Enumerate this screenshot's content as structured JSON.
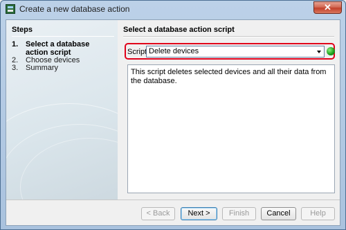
{
  "window": {
    "title": "Create a new database action",
    "close_symbol": "✕"
  },
  "steps": {
    "heading": "Steps",
    "items": [
      {
        "number": "1.",
        "label": "Select a database action script",
        "active": true
      },
      {
        "number": "2.",
        "label": "Choose devices",
        "active": false
      },
      {
        "number": "3.",
        "label": "Summary",
        "active": false
      }
    ]
  },
  "content": {
    "heading": "Select a database action script",
    "script_label": "Script",
    "script_value": "Delete devices",
    "description": "This script deletes selected devices and all their data from the database."
  },
  "buttons": {
    "back": "< Back",
    "next": "Next >",
    "finish": "Finish",
    "cancel": "Cancel",
    "help": "Help"
  },
  "icons": {
    "app": "database-app-icon",
    "status": "green-status-icon",
    "dropdown": "chevron-down-icon",
    "close": "close-icon"
  },
  "colors": {
    "highlight": "#e0001a",
    "status_green": "#1fa21f"
  }
}
